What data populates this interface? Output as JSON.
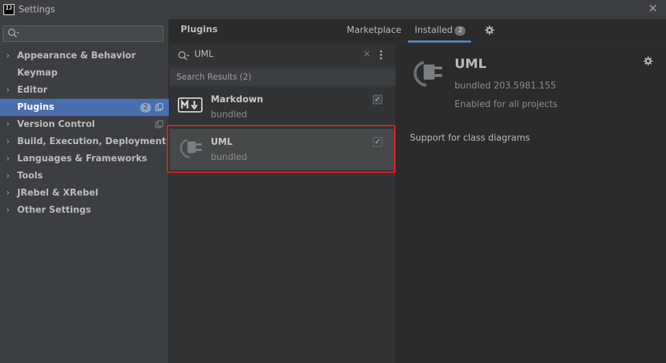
{
  "window": {
    "title": "Settings",
    "logo_text": "IJ"
  },
  "sidebar": {
    "search": {
      "value": "",
      "placeholder": ""
    },
    "items": [
      {
        "label": "Appearance & Behavior",
        "expandable": true
      },
      {
        "label": "Keymap",
        "expandable": false
      },
      {
        "label": "Editor",
        "expandable": true
      },
      {
        "label": "Plugins",
        "expandable": false,
        "selected": true,
        "badge": "2"
      },
      {
        "label": "Version Control",
        "expandable": true
      },
      {
        "label": "Build, Execution, Deployment",
        "expandable": true
      },
      {
        "label": "Languages & Frameworks",
        "expandable": true
      },
      {
        "label": "Tools",
        "expandable": true
      },
      {
        "label": "JRebel & XRebel",
        "expandable": true
      },
      {
        "label": "Other Settings",
        "expandable": true
      }
    ]
  },
  "header": {
    "title": "Plugins",
    "tabs": [
      {
        "label": "Marketplace",
        "active": false
      },
      {
        "label": "Installed",
        "active": true,
        "badge": "2"
      }
    ]
  },
  "plugin_list": {
    "search_query": "UML",
    "results_label": "Search Results (2)",
    "plugins": [
      {
        "name": "Markdown",
        "subtitle": "bundled",
        "enabled": true,
        "icon": "markdown-icon"
      },
      {
        "name": "UML",
        "subtitle": "bundled",
        "enabled": true,
        "icon": "plug-icon",
        "selected": true
      }
    ]
  },
  "details": {
    "name": "UML",
    "version": "bundled 203.5981.155",
    "status": "Enabled for all projects",
    "description": "Support for class diagrams"
  },
  "colors": {
    "selection": "#4b6eaf",
    "tab_underline": "#4a88c7",
    "highlight_outline": "#e5221f"
  }
}
